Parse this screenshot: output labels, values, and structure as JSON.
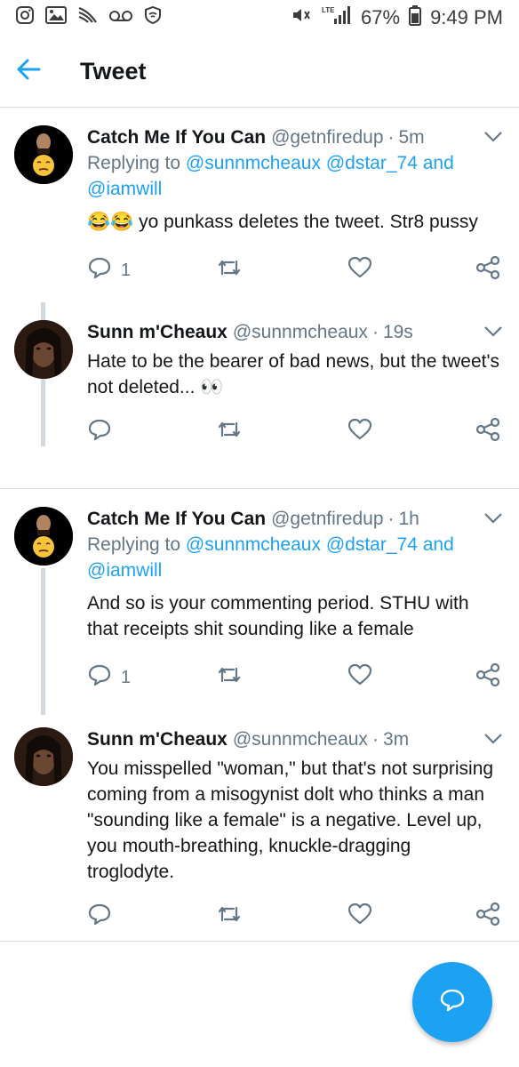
{
  "status_bar": {
    "battery": "67%",
    "time": "9:49 PM",
    "network": "LTE"
  },
  "app_bar": {
    "title": "Tweet"
  },
  "threads": [
    {
      "tweets": [
        {
          "name": "Catch Me If You Can",
          "handle": "@getnfiredup",
          "time": "5m",
          "replying_prefix": "Replying to",
          "mentions": [
            "@sunnmcheaux",
            "@dstar_74",
            "@iamwill"
          ],
          "and_text": "and",
          "text": "yo punkass deletes the tweet. Str8 pussy",
          "emoji_prefix": "😂😂",
          "reply_count": "1"
        },
        {
          "name": "Sunn m'Cheaux",
          "handle": "@sunnmcheaux",
          "time": "19s",
          "text": "Hate to be the bearer of bad news, but the tweet's not deleted...",
          "emoji_suffix": "👀",
          "reply_count": ""
        }
      ]
    },
    {
      "tweets": [
        {
          "name": "Catch Me If You Can",
          "handle": "@getnfiredup",
          "time": "1h",
          "replying_prefix": "Replying to",
          "mentions": [
            "@sunnmcheaux",
            "@dstar_74",
            "@iamwill"
          ],
          "and_text": "and",
          "text": "And so is your commenting period. STHU with that receipts shit sounding like a female",
          "reply_count": "1"
        },
        {
          "name": "Sunn m'Cheaux",
          "handle": "@sunnmcheaux",
          "time": "3m",
          "text": "You misspelled \"woman,\" but that's not surprising coming from a misogynist dolt who thinks a man \"sounding like a female\" is a negative. Level up, you mouth-breathing, knuckle-dragging troglodyte.",
          "reply_count": ""
        }
      ]
    }
  ],
  "colors": {
    "accent": "#1da1f2",
    "secondary_text": "#657786",
    "divider": "#d6dbdf"
  }
}
